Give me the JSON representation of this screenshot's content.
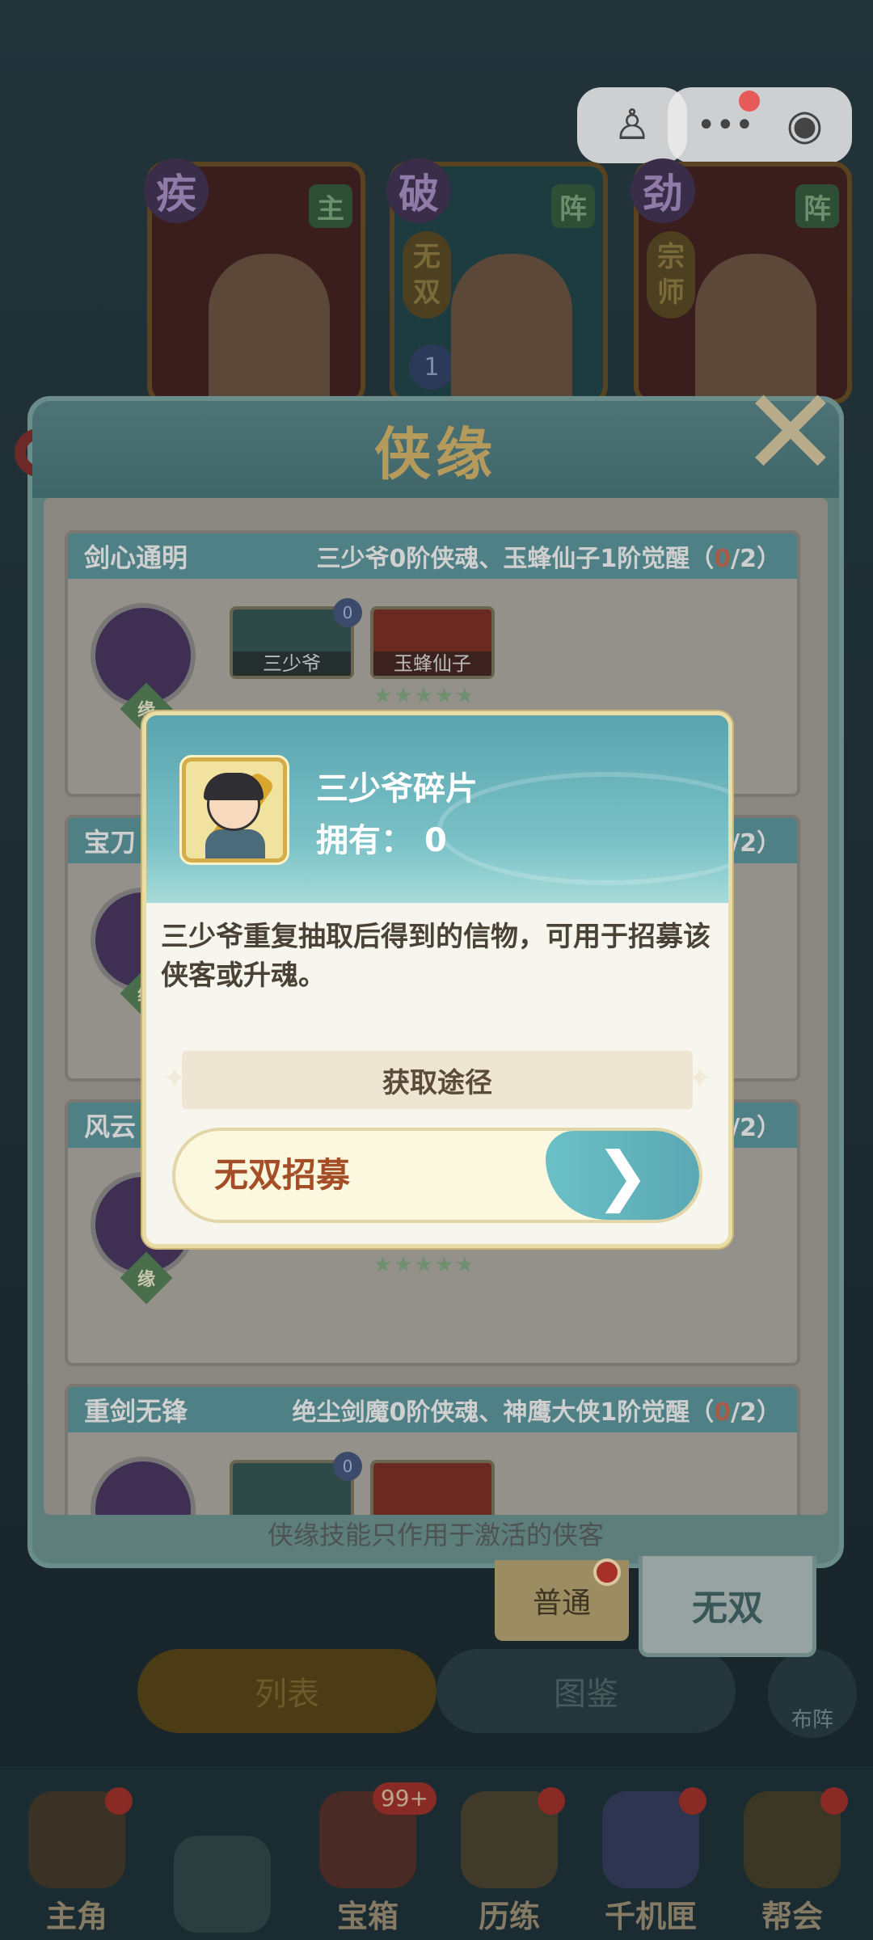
{
  "top_heroes": [
    {
      "element": "疾",
      "tag": "主",
      "title": ""
    },
    {
      "element": "破",
      "tag": "阵",
      "title": "无双",
      "level": "1"
    },
    {
      "element": "劲",
      "tag": "阵",
      "title": "宗师"
    }
  ],
  "dialog": {
    "title": "侠缘",
    "footer_note": "侠缘技能只作用于激活的侠客",
    "bonds": [
      {
        "name": "剑心通明",
        "condition": "三少爷0阶侠魂、玉蜂仙子1阶觉醒（",
        "progress_current": "0",
        "progress_total": "/2）",
        "badge": "缘",
        "members": [
          {
            "name": "三少爷",
            "level": "0"
          },
          {
            "name": "玉蜂仙子"
          }
        ],
        "stars": "★★★★★"
      },
      {
        "name": "宝刀",
        "condition": "",
        "progress_current": "0",
        "progress_total": "/2）",
        "badge": "缘"
      },
      {
        "name": "风云",
        "condition": "",
        "progress_current": "0",
        "progress_total": "/2）",
        "badge": "缘",
        "stars": "★★★★★"
      },
      {
        "name": "重剑无锋",
        "condition": "绝尘剑魔0阶侠魂、神鹰大侠1阶觉醒（",
        "progress_current": "0",
        "progress_total": "/2）",
        "badge": "缘",
        "members": [
          {
            "name": "",
            "level": "0"
          },
          {
            "name": ""
          }
        ]
      }
    ],
    "modes": {
      "normal": "普通",
      "wushuang": "无双"
    }
  },
  "popup": {
    "item_name": "三少爷碎片",
    "own_label": "拥有：",
    "own_count": "0",
    "description": "三少爷重复抽取后得到的信物，可用于招募该侠客或升魂。",
    "source_heading": "获取途径",
    "source_button": "无双招募",
    "arrow_icon": "chevron-right-icon"
  },
  "list_tabs": {
    "list": "列表",
    "catalog": "图鉴",
    "formation": "布阵"
  },
  "nav": [
    {
      "label": "主角"
    },
    {
      "label": ""
    },
    {
      "label": "宝箱",
      "badge": "99+"
    },
    {
      "label": "历练"
    },
    {
      "label": "千机匣"
    },
    {
      "label": "帮会"
    }
  ]
}
